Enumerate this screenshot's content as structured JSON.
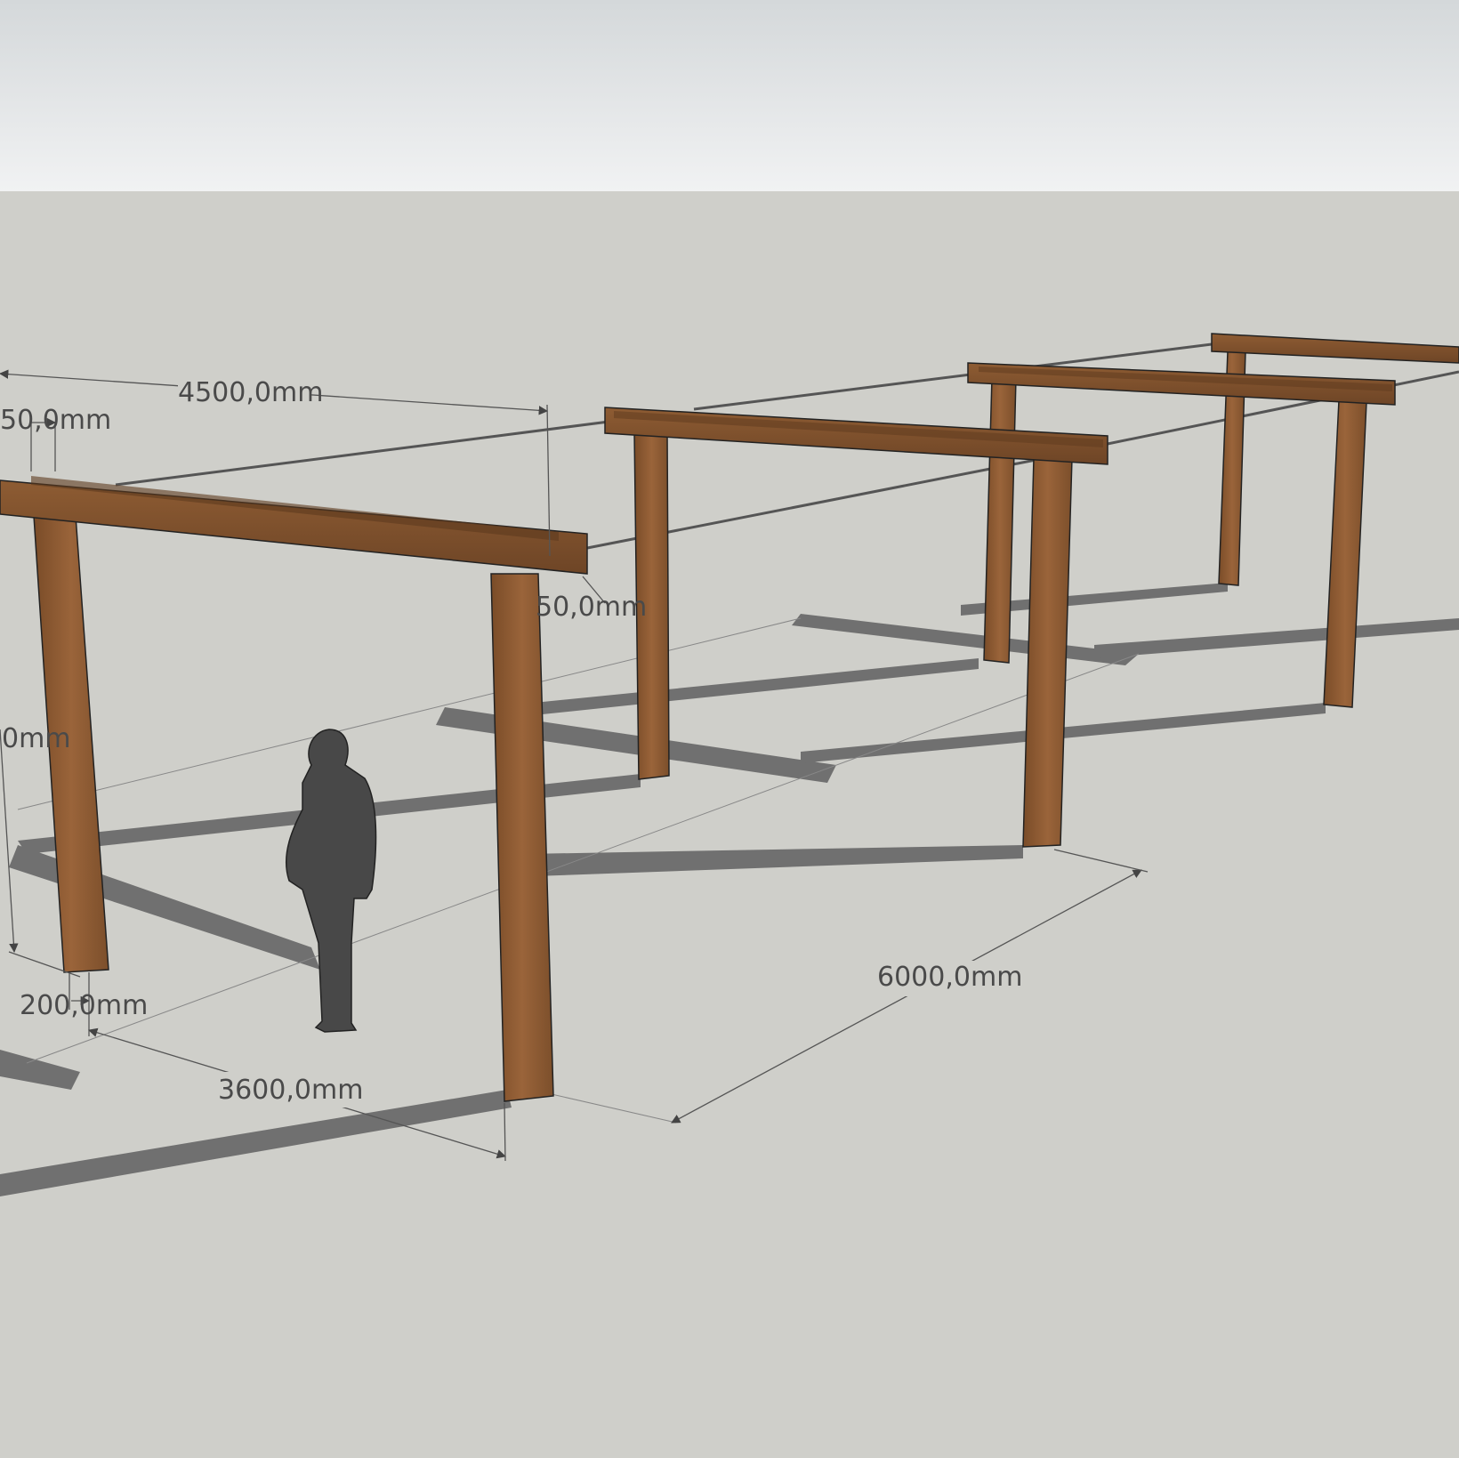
{
  "colors": {
    "sky_top": "#d4d8da",
    "sky_bottom": "#f1f2f3",
    "ground": "#cfcfca",
    "wood": "#8a5a32",
    "wood_light": "#a46b3c",
    "wood_dark": "#6b4424",
    "shadow": "#707070",
    "figure": "#484848",
    "dimension_line": "#555555",
    "cable": "#555555"
  },
  "icons": [
    "human-scale-figure"
  ],
  "dimensions": {
    "beam_span": "4500,0mm",
    "beam_width_top": "50,0mm",
    "beam_width_front": "50,0mm",
    "post_height": "0mm",
    "post_width": "200,0mm",
    "post_spacing": "3600,0mm",
    "bay_length": "6000,0mm"
  }
}
